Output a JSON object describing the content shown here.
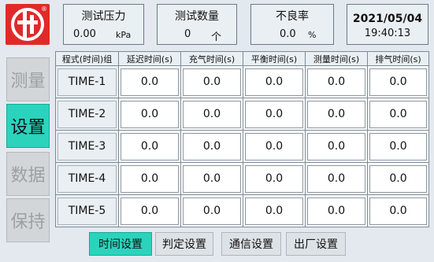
{
  "header": {
    "pressure": {
      "caption": "测试压力",
      "value": "0.00",
      "unit": "kPa"
    },
    "quantity": {
      "caption": "测试数量",
      "value": "0",
      "unit": "个"
    },
    "defect_rate": {
      "caption": "不良率",
      "value": "0.0",
      "unit": "%"
    },
    "date": "2021/05/04",
    "time": "19:40:13"
  },
  "side_menu": [
    {
      "label": "测量",
      "active": false
    },
    {
      "label": "设置",
      "active": true
    },
    {
      "label": "数据",
      "active": false
    },
    {
      "label": "保持",
      "active": false
    }
  ],
  "table": {
    "columns": [
      "程式(时间)组",
      "延迟时间(s)",
      "充气时间(s)",
      "平衡时间(s)",
      "测量时间(s)",
      "排气时间(s)"
    ],
    "rows": [
      {
        "name": "TIME-1",
        "values": [
          "0.0",
          "0.0",
          "0.0",
          "0.0",
          "0.0"
        ]
      },
      {
        "name": "TIME-2",
        "values": [
          "0.0",
          "0.0",
          "0.0",
          "0.0",
          "0.0"
        ]
      },
      {
        "name": "TIME-3",
        "values": [
          "0.0",
          "0.0",
          "0.0",
          "0.0",
          "0.0"
        ]
      },
      {
        "name": "TIME-4",
        "values": [
          "0.0",
          "0.0",
          "0.0",
          "0.0",
          "0.0"
        ]
      },
      {
        "name": "TIME-5",
        "values": [
          "0.0",
          "0.0",
          "0.0",
          "0.0",
          "0.0"
        ]
      }
    ]
  },
  "tabs": [
    {
      "label": "时间设置",
      "active": true
    },
    {
      "label": "判定设置",
      "active": false
    },
    {
      "label": "通信设置",
      "active": false
    },
    {
      "label": "出厂设置",
      "active": false
    }
  ],
  "colors": {
    "accent": "#2bd3bd",
    "logo": "#e02a2a"
  },
  "icons": {
    "logo": "brand-logo-icon"
  }
}
